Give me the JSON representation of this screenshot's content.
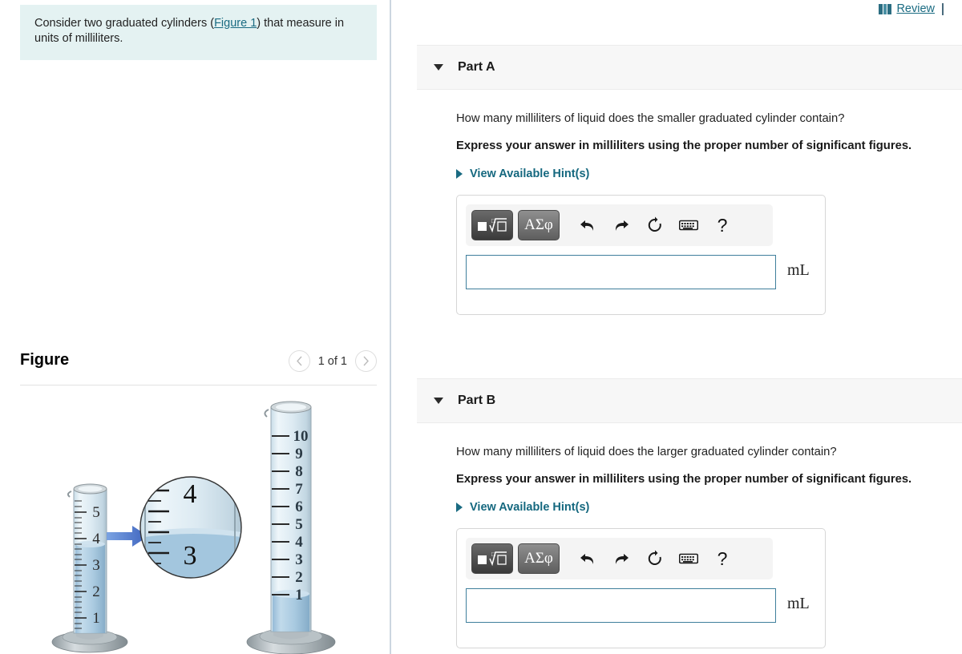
{
  "intro": {
    "text_before": "Consider two graduated cylinders (",
    "link_label": "Figure 1",
    "text_after": ") that measure in units of milliliters."
  },
  "header": {
    "review_label": "Review",
    "review_icon": "book-icon"
  },
  "figure": {
    "title": "Figure",
    "pagination": "1 of 1",
    "prev_icon": "chevron-left-icon",
    "next_icon": "chevron-right-icon",
    "small_cylinder": {
      "ticks": [
        "5",
        "4",
        "3",
        "2",
        "1"
      ],
      "liquid_level_ml": 3.7,
      "max_ml": 5
    },
    "large_cylinder": {
      "ticks": [
        "10",
        "9",
        "8",
        "7",
        "6",
        "5",
        "4",
        "3",
        "2",
        "1"
      ],
      "liquid_level_ml": 1.2,
      "max_ml": 10
    },
    "magnifier": {
      "upper_label": "4",
      "lower_label": "3"
    },
    "colors": {
      "liquid": "#a8c8e0",
      "glass": "#dfeaf1",
      "base": "#a9b2b6",
      "arrow": "#3f6fd1"
    }
  },
  "parts": [
    {
      "id": "a",
      "label": "Part A",
      "caret_icon": "caret-down-icon",
      "question": "How many milliliters of liquid does the smaller graduated cylinder contain?",
      "instruction": "Express your answer in milliliters using the proper number of significant figures.",
      "hint_label": "View Available Hint(s)",
      "hint_icon": "caret-right-icon",
      "toolbar": {
        "math_label": "math-template-button",
        "greek_label": "ΑΣφ",
        "undo_icon": "undo-arrow-icon",
        "redo_icon": "redo-arrow-icon",
        "reset_icon": "reset-circular-arrow-icon",
        "keyboard_icon": "keyboard-icon",
        "help_icon": "question-mark-icon",
        "help_label": "?"
      },
      "answer_value": "",
      "answer_placeholder": "",
      "unit": "mL"
    },
    {
      "id": "b",
      "label": "Part B",
      "caret_icon": "caret-down-icon",
      "question": "How many milliliters of liquid does the larger graduated cylinder contain?",
      "instruction": "Express your answer in milliliters using the proper number of significant figures.",
      "hint_label": "View Available Hint(s)",
      "hint_icon": "caret-right-icon",
      "toolbar": {
        "math_label": "math-template-button",
        "greek_label": "ΑΣφ",
        "undo_icon": "undo-arrow-icon",
        "redo_icon": "redo-arrow-icon",
        "reset_icon": "reset-circular-arrow-icon",
        "keyboard_icon": "keyboard-icon",
        "help_icon": "question-mark-icon",
        "help_label": "?"
      },
      "answer_value": "",
      "answer_placeholder": "",
      "unit": "mL"
    }
  ]
}
